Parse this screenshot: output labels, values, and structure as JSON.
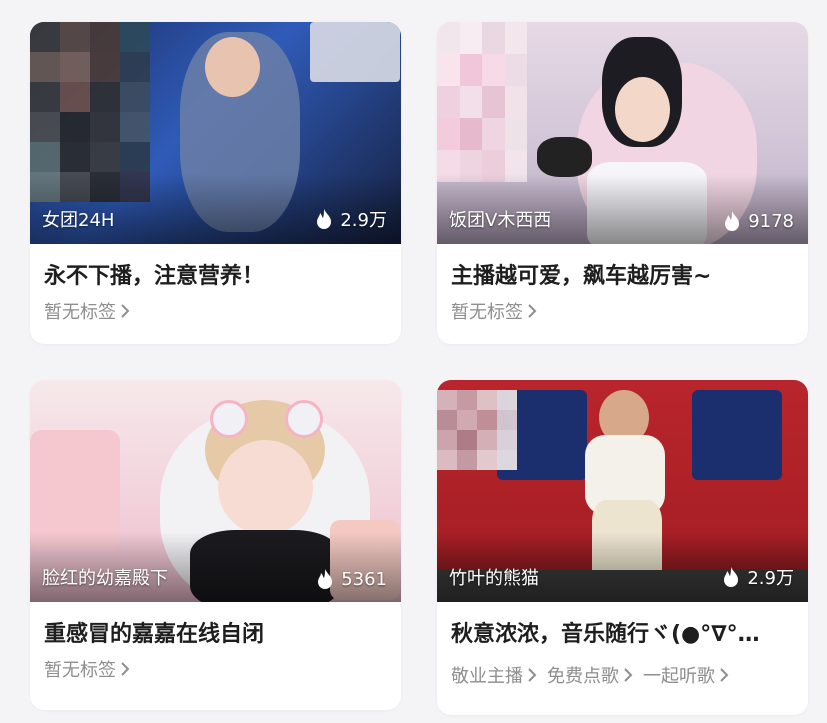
{
  "cards": [
    {
      "host": "女团24H",
      "heat": "2.9万",
      "title": "永不下播，注意营养！",
      "tags": [
        "暂无标签"
      ]
    },
    {
      "host": "饭团V木西西",
      "heat": "9178",
      "title": "主播越可爱，飙车越厉害~",
      "tags": [
        "暂无标签"
      ]
    },
    {
      "host": "脸红的幼嘉殿下",
      "heat": "5361",
      "title": "重感冒的嘉嘉在线自闭",
      "tags": [
        "暂无标签"
      ]
    },
    {
      "host": "竹叶的熊猫",
      "heat": "2.9万",
      "title": "秋意浓浓，音乐随行ヾ(●°∇°…",
      "tags": [
        "敬业主播",
        "免费点歌",
        "一起听歌"
      ]
    }
  ],
  "icons": {
    "heat": "flame-icon",
    "tag_arrow": "chevron-right-icon"
  },
  "colors": {
    "title": "#1e1e1e",
    "tag": "#8e8e8e",
    "card_bg": "#ffffff",
    "page_bg": "#f4f4f6"
  }
}
